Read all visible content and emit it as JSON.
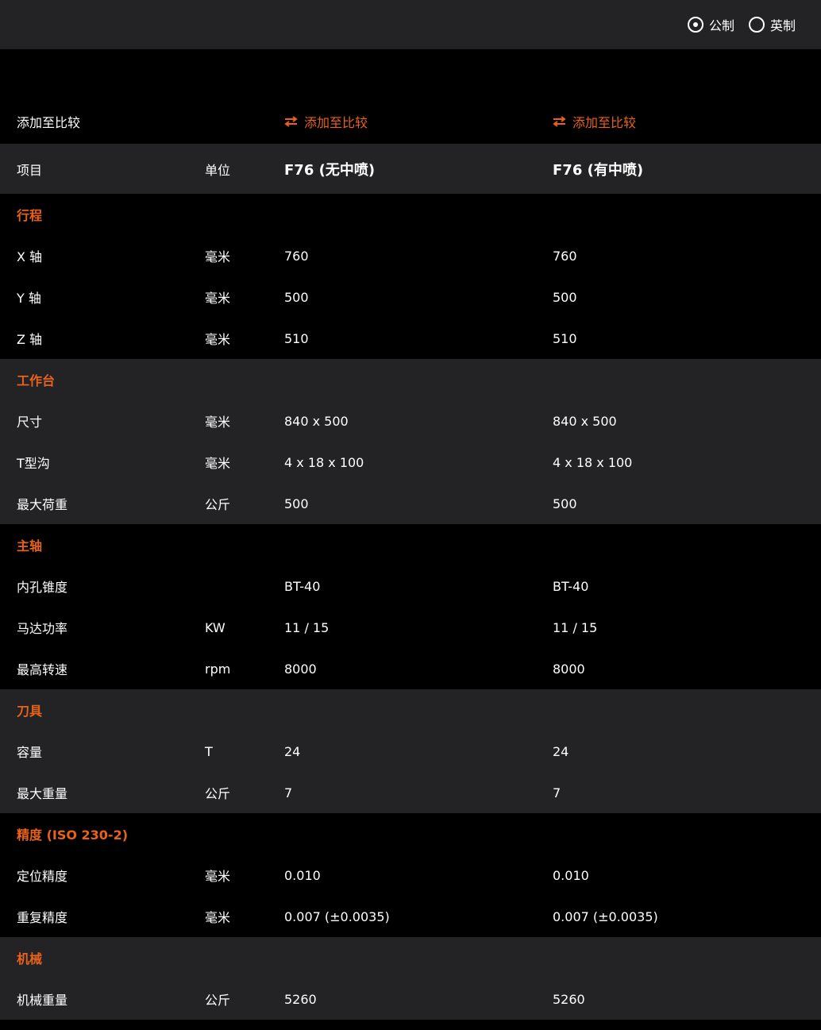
{
  "units_toggle": {
    "options": [
      {
        "label": "公制",
        "checked": true
      },
      {
        "label": "英制",
        "checked": false
      }
    ]
  },
  "compare": {
    "row_label": "添加至比较",
    "link_label_1": "添加至比较",
    "link_label_2": "添加至比较",
    "icon": "swap-arrows-icon"
  },
  "header": {
    "item": "项目",
    "unit": "单位",
    "model_1": "F76 (无中喷)",
    "model_2": "F76 (有中喷)"
  },
  "colors": {
    "accent": "#e8621a",
    "gray_band": "#232325",
    "black_band": "#000000"
  },
  "sections": [
    {
      "title": "行程",
      "rows": [
        {
          "name": "X 轴",
          "unit": "毫米",
          "v1": "760",
          "v2": "760"
        },
        {
          "name": "Y 轴",
          "unit": "毫米",
          "v1": "500",
          "v2": "500"
        },
        {
          "name": "Z 轴",
          "unit": "毫米",
          "v1": "510",
          "v2": "510"
        }
      ]
    },
    {
      "title": "工作台",
      "rows": [
        {
          "name": "尺寸",
          "unit": "毫米",
          "v1": "840 x 500",
          "v2": "840 x 500"
        },
        {
          "name": "T型沟",
          "unit": "毫米",
          "v1": "4 x 18 x 100",
          "v2": "4 x 18 x 100"
        },
        {
          "name": "最大荷重",
          "unit": "公斤",
          "v1": "500",
          "v2": "500"
        }
      ]
    },
    {
      "title": "主轴",
      "rows": [
        {
          "name": "内孔锥度",
          "unit": "",
          "v1": "BT-40",
          "v2": "BT-40"
        },
        {
          "name": "马达功率",
          "unit": "KW",
          "v1": "11 / 15",
          "v2": "11 / 15"
        },
        {
          "name": "最高转速",
          "unit": "rpm",
          "v1": "8000",
          "v2": "8000"
        }
      ]
    },
    {
      "title": "刀具",
      "rows": [
        {
          "name": "容量",
          "unit": "T",
          "v1": "24",
          "v2": "24"
        },
        {
          "name": "最大重量",
          "unit": "公斤",
          "v1": "7",
          "v2": "7"
        }
      ]
    },
    {
      "title": "精度 (ISO 230-2)",
      "rows": [
        {
          "name": "定位精度",
          "unit": "毫米",
          "v1": "0.010",
          "v2": "0.010"
        },
        {
          "name": "重复精度",
          "unit": "毫米",
          "v1": "0.007 (±0.0035)",
          "v2": "0.007 (±0.0035)"
        }
      ]
    },
    {
      "title": "机械",
      "rows": [
        {
          "name": "机械重量",
          "unit": "公斤",
          "v1": "5260",
          "v2": "5260"
        }
      ]
    }
  ]
}
